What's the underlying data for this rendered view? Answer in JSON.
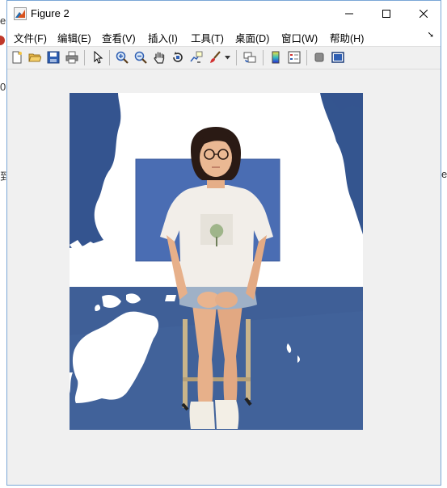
{
  "window": {
    "title": "Figure 2",
    "minimize_label": "─",
    "maximize_label": "☐",
    "close_label": "✕"
  },
  "menu": {
    "items": [
      {
        "label": "文件(F)"
      },
      {
        "label": "编辑(E)"
      },
      {
        "label": "查看(V)"
      },
      {
        "label": "插入(I)"
      },
      {
        "label": "工具(T)"
      },
      {
        "label": "桌面(D)"
      },
      {
        "label": "窗口(W)"
      },
      {
        "label": "帮助(H)"
      }
    ],
    "overflow_icon": "dock-arrow-icon"
  },
  "toolbar": {
    "buttons": [
      "new-figure-icon",
      "open-file-icon",
      "save-icon",
      "print-icon",
      "pointer-icon",
      "zoom-in-icon",
      "zoom-out-icon",
      "pan-icon",
      "rotate-3d-icon",
      "data-cursor-icon",
      "brush-icon",
      "link-plot-icon",
      "colorbar-icon",
      "legend-icon",
      "hide-plot-tools-icon",
      "show-plot-tools-icon"
    ]
  },
  "background_fragments": {
    "left_e": "e",
    "left_0": "0",
    "left_tao": "到",
    "right_e": "e"
  },
  "colors": {
    "backdrop_blue": "#3a5f9e",
    "panel_blue": "#4468b0",
    "floor_blue": "#3e5f98",
    "mask_white": "#ffffff",
    "window_gray": "#f0f0f0",
    "accent_border": "#7aa7d6"
  }
}
